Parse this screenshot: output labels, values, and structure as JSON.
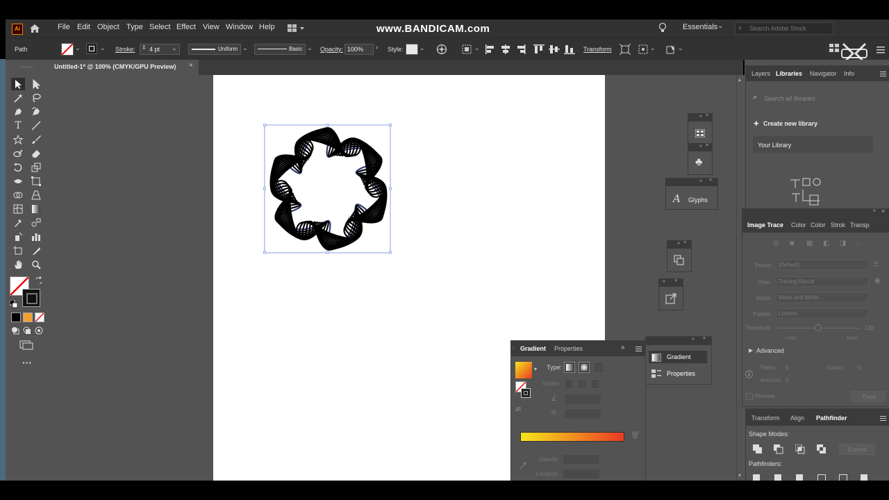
{
  "watermark": "www.BANDICAM.com",
  "app": {
    "logo": "Ai"
  },
  "menu": [
    "File",
    "Edit",
    "Object",
    "Type",
    "Select",
    "Effect",
    "View",
    "Window",
    "Help"
  ],
  "workspace": "Essentials",
  "search_placeholder": "Search Adobe Stock",
  "control": {
    "selection_label": "Path",
    "stroke_label": "Stroke:",
    "stroke_value": "4 pt",
    "profile_label": "Uniform",
    "brush_label": "Basic",
    "opacity_label": "Opacity:",
    "opacity_value": "100%",
    "style_label": "Style:",
    "transform_label": "Transform"
  },
  "document_tab": "Untitled-1* @ 100% (CMYK/GPU Preview)",
  "libraries_panel": {
    "tabs": [
      "Layers",
      "Libraries",
      "Navigator",
      "Info"
    ],
    "active_tab": "Libraries",
    "search_placeholder": "Search all libraries",
    "create_label": "Create new library",
    "library_name": "Your Library"
  },
  "glyphs_label": "Glyphs",
  "image_trace_panel": {
    "tabs": [
      "Image Trace",
      "Color",
      "Color",
      "Strok",
      "Transp"
    ],
    "preset_label": "Preset:",
    "preset_value": "[Default]",
    "view_label": "View:",
    "view_value": "Tracing Result",
    "mode_label": "Mode:",
    "mode_value": "Black and White",
    "palette_label": "Palette:",
    "palette_value": "Limited",
    "threshold_label": "Threshold:",
    "threshold_value": "128",
    "less_label": "Less",
    "more_label": "More",
    "advanced_label": "Advanced",
    "paths_label": "Paths:",
    "paths_value": "0",
    "colors_label": "Colors:",
    "colors_value": "0",
    "anchors_label": "Anchors:",
    "anchors_value": "0",
    "preview_label": "Preview",
    "trace_label": "Trace"
  },
  "pathfinder_panel": {
    "tabs": [
      "Transform",
      "Align",
      "Pathfinder"
    ],
    "shape_modes_label": "Shape Modes:",
    "expand_label": "Expand",
    "pathfinders_label": "Pathfinders:"
  },
  "gradient_panel": {
    "tabs": [
      "Gradient",
      "Properties"
    ],
    "type_label": "Type:",
    "stroke_label": "Stroke:",
    "opacity_label": "Opacity:",
    "location_label": "Location:"
  },
  "collapsed_panels": [
    "Gradient",
    "Properties"
  ],
  "colors": {
    "gradient_start": "#f7e51a",
    "gradient_end": "#ea3a24",
    "ui_dark": "#323232",
    "ui_mid": "#535353"
  }
}
